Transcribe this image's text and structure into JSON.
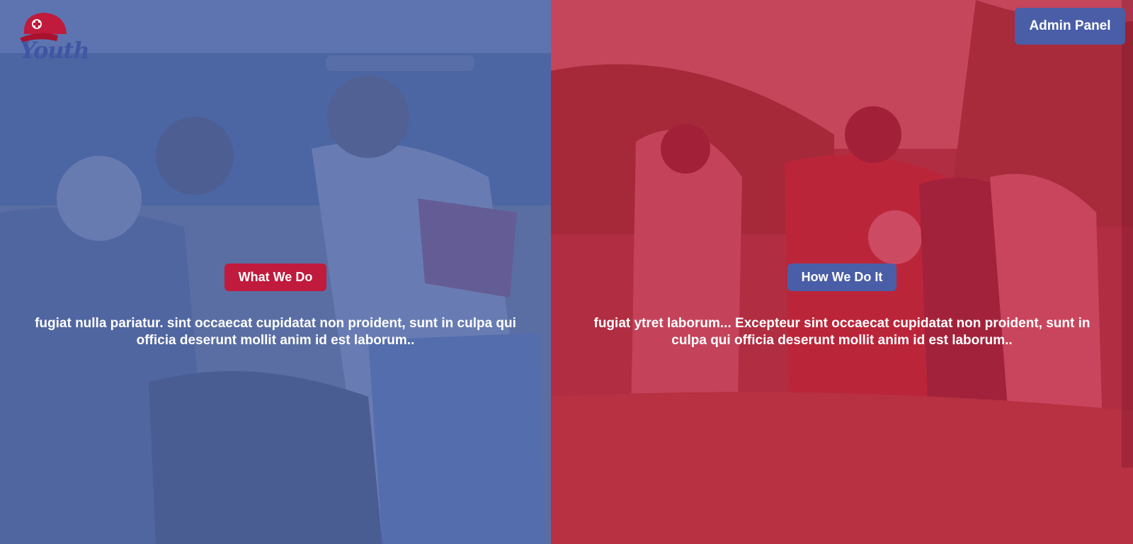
{
  "header": {
    "logo_text": "Youth",
    "admin_button": "Admin Panel"
  },
  "panels": [
    {
      "button_label": "What We Do",
      "description": "fugiat nulla pariatur. sint occaecat cupidatat non proident, sunt in culpa qui officia deserunt mollit anim id est laborum..",
      "tint_color": "#536aaa"
    },
    {
      "button_label": "How We Do It",
      "description": "fugiat ytret laborum... Excepteur sint occaecat cupidatat non proident, sunt in culpa qui officia deserunt mollit anim id est laborum..",
      "tint_color": "#c4203f"
    }
  ],
  "icons": [
    "cap-logo-icon"
  ],
  "colors": {
    "accent_red": "#c01a3c",
    "accent_blue": "#4a5ea8"
  }
}
